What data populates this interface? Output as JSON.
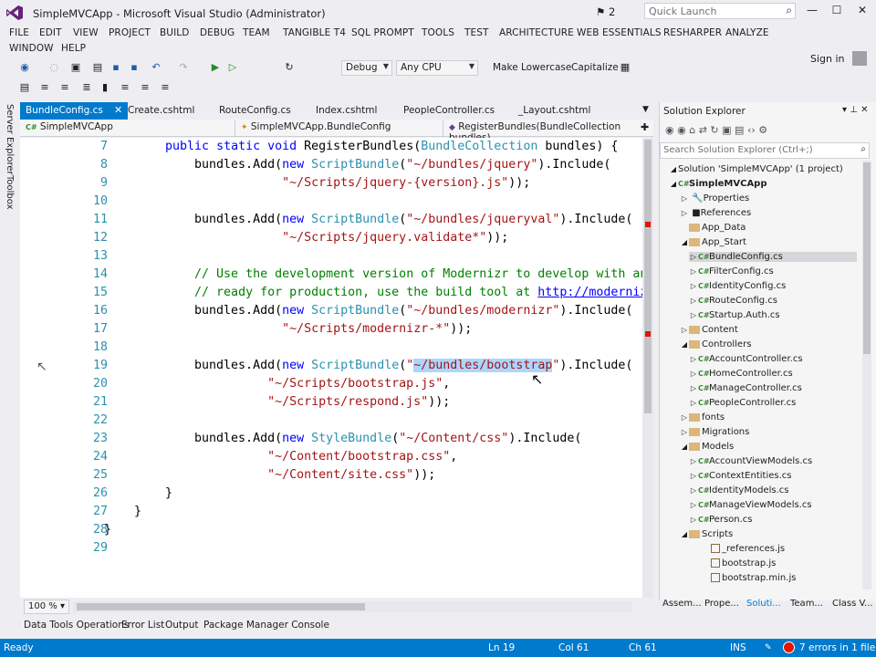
{
  "window": {
    "title": "SimpleMVCApp - Microsoft Visual Studio (Administrator)",
    "notifications": "2",
    "quick_launch_placeholder": "Quick Launch",
    "sign_in": "Sign in"
  },
  "menu": [
    "FILE",
    "EDIT",
    "VIEW",
    "PROJECT",
    "BUILD",
    "DEBUG",
    "TEAM",
    "TANGIBLE T4",
    "SQL PROMPT",
    "TOOLS",
    "TEST",
    "ARCHITECTURE",
    "WEB ESSENTIALS",
    "RESHARPER",
    "ANALYZE",
    "WINDOW",
    "HELP"
  ],
  "toolbar": {
    "config": "Debug",
    "platform": "Any CPU",
    "make_lowercase": "Make Lowercase",
    "capitalize": "Capitalize"
  },
  "side_tabs": [
    "Server Explorer",
    "Toolbox"
  ],
  "doc_tabs": [
    "BundleConfig.cs",
    "Create.cshtml",
    "RouteConfig.cs",
    "Index.cshtml",
    "PeopleController.cs",
    "_Layout.cshtml"
  ],
  "nav": {
    "project": "SimpleMVCApp",
    "class": "SimpleMVCApp.BundleConfig",
    "member": "RegisterBundles(BundleCollection bundles)"
  },
  "editor": {
    "line_numbers": [
      "7",
      "8",
      "9",
      "10",
      "11",
      "12",
      "13",
      "14",
      "15",
      "16",
      "17",
      "18",
      "19",
      "20",
      "21",
      "22",
      "23",
      "24",
      "25",
      "26",
      "27",
      "28",
      "29"
    ],
    "zoom": "100 %"
  },
  "solution_explorer": {
    "title": "Solution Explorer",
    "search_placeholder": "Search Solution Explorer (Ctrl+;)",
    "items": [
      "Solution 'SimpleMVCApp' (1 project)",
      "SimpleMVCApp",
      "Properties",
      "References",
      "App_Data",
      "App_Start",
      "BundleConfig.cs",
      "FilterConfig.cs",
      "IdentityConfig.cs",
      "RouteConfig.cs",
      "Startup.Auth.cs",
      "Content",
      "Controllers",
      "AccountController.cs",
      "HomeController.cs",
      "ManageController.cs",
      "PeopleController.cs",
      "fonts",
      "Migrations",
      "Models",
      "AccountViewModels.cs",
      "ContextEntities.cs",
      "IdentityModels.cs",
      "ManageViewModels.cs",
      "Person.cs",
      "Scripts",
      "_references.js",
      "bootstrap.js",
      "bootstrap.min.js"
    ],
    "bottom_tabs": [
      "Assem...",
      "Prope...",
      "Soluti...",
      "Team...",
      "Class V..."
    ]
  },
  "bottom_tabs": [
    "Data Tools Operations",
    "Error List",
    "Output",
    "Package Manager Console"
  ],
  "status": {
    "ready": "Ready",
    "line": "Ln 19",
    "col": "Col 61",
    "ch": "Ch 61",
    "ins": "INS",
    "errors": "7 errors in 1 file"
  }
}
